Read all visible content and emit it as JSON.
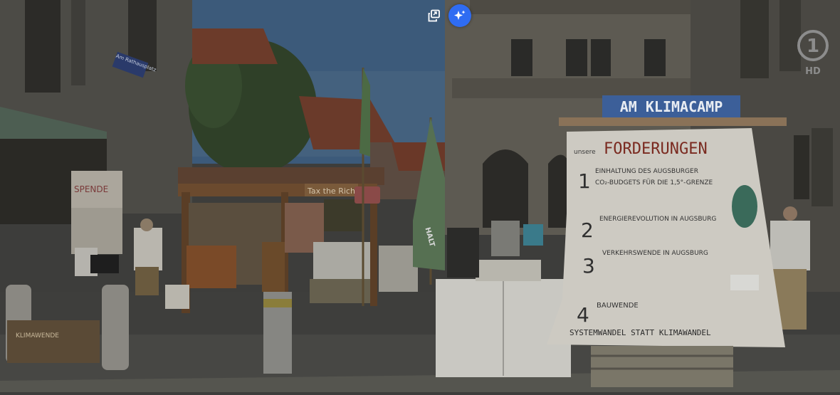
{
  "overlay": {
    "popout_icon": "picture-in-picture-icon",
    "ai_icon": "sparkle-icon",
    "accent_color": "#2f6cf2"
  },
  "broadcaster": {
    "logo_mark": "1",
    "logo_text": "HD"
  },
  "scene": {
    "banner_sign": "AM KLIMACAMP",
    "poster": {
      "heading_prefix": "unsere",
      "heading": "FORDERUNGEN",
      "demands": [
        {
          "number": "1",
          "line1": "EINHALTUNG DES AUGSBURGER",
          "line2": "CO₂-BUDGETS FÜR DIE 1,5°-GRENZE"
        },
        {
          "number": "2",
          "line1": "ENERGIEREVOLUTION IN AUGSBURG",
          "line2": ""
        },
        {
          "number": "3",
          "line1": "VERKEHRSWENDE IN AUGSBURG",
          "line2": ""
        },
        {
          "number": "4",
          "line1": "BAUWENDE",
          "line2": ""
        }
      ],
      "footer": "SYSTEMWANDEL STATT KLIMAWANDEL"
    },
    "street_sign": "Am Rathausplatz",
    "spende_sign": "SPENDE",
    "tax_sign": "Tax the Rich",
    "flag_text": "HALT",
    "klimawende_sign": "KLIMAWENDE"
  }
}
